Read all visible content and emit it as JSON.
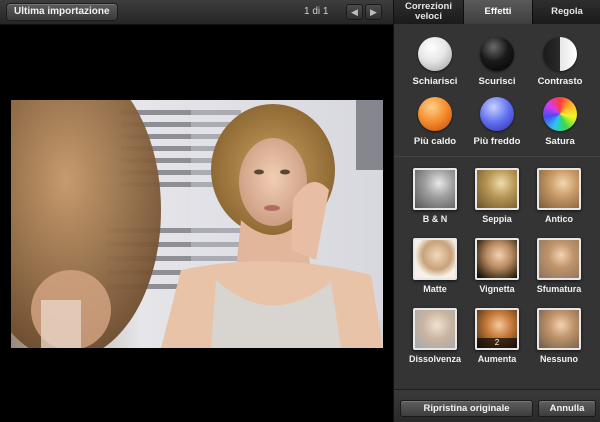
{
  "toolbar": {
    "album_label": "Ultima importazione",
    "counter": "1 di 1",
    "prev_icon": "arrow-left-icon",
    "next_icon": "arrow-right-icon"
  },
  "tabs": [
    {
      "label": "Correzioni veloci",
      "active": false
    },
    {
      "label": "Effetti",
      "active": true
    },
    {
      "label": "Regola",
      "active": false
    }
  ],
  "quick_fixes": [
    {
      "label": "Schiarisci",
      "icon": "white-orb-icon"
    },
    {
      "label": "Scurisci",
      "icon": "black-orb-icon"
    },
    {
      "label": "Contrasto",
      "icon": "half-orb-icon"
    },
    {
      "label": "Più caldo",
      "icon": "orange-orb-icon"
    },
    {
      "label": "Più freddo",
      "icon": "blue-orb-icon"
    },
    {
      "label": "Satura",
      "icon": "rainbow-orb-icon"
    }
  ],
  "effects": [
    {
      "label": "B & N",
      "badge": ""
    },
    {
      "label": "Seppia",
      "badge": ""
    },
    {
      "label": "Antico",
      "badge": ""
    },
    {
      "label": "Matte",
      "badge": ""
    },
    {
      "label": "Vignetta",
      "badge": ""
    },
    {
      "label": "Sfumatura",
      "badge": ""
    },
    {
      "label": "Dissolvenza",
      "badge": ""
    },
    {
      "label": "Aumenta",
      "badge": "2"
    },
    {
      "label": "Nessuno",
      "badge": ""
    }
  ],
  "footer": {
    "reset_label": "Ripristina originale",
    "cancel_label": "Annulla"
  }
}
